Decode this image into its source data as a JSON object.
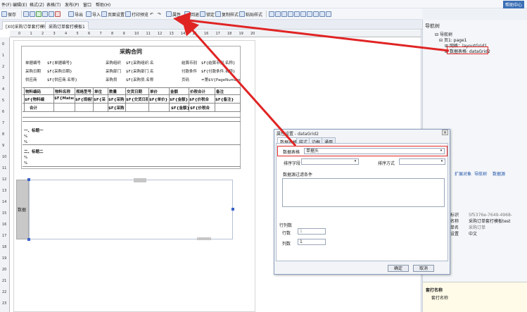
{
  "menubar": {
    "items": [
      "件(F)",
      "编辑(E)",
      "格式(Z)",
      "表格(T)",
      "发布(P)",
      "窗口",
      "帮助(H)"
    ],
    "help_link": "帮助中心"
  },
  "toolbar": {
    "save": "保存",
    "export": "导出",
    "import": "导入",
    "page_setup": "页面设置",
    "print_preview": "打印预览",
    "properties": "属性",
    "rollback": "回退",
    "lock": "锁定",
    "copy_style": "复制样式",
    "paste_style": "粘贴样式"
  },
  "tabs": [
    "[X0]采购订单套打模板",
    "采购订单套打模板1"
  ],
  "rulers": {
    "h": [
      "0",
      "1",
      "2",
      "3",
      "4",
      "5",
      "6",
      "7",
      "8",
      "9",
      "10",
      "11",
      "12",
      "13",
      "14",
      "15",
      "16",
      "17",
      "18",
      "19",
      "20"
    ],
    "v": [
      "0",
      "1",
      "2",
      "3",
      "4",
      "5",
      "6",
      "7",
      "8",
      "9",
      "10",
      "11",
      "12",
      "13",
      "14",
      "15",
      "16",
      "17",
      "18",
      "19",
      "20",
      "21",
      "22",
      "23"
    ]
  },
  "form": {
    "title": "采购合同",
    "rows": [
      [
        "单据编号",
        "$F{单据编号}",
        "采购组织",
        "$F{采购组织.名",
        "结算币别",
        "$F{结算币别.名称}"
      ],
      [
        "采购日期",
        "$F{采购日期}",
        "采购部门",
        "$F{采购部门.名",
        "付款条件",
        "$F{付款条件.名称}"
      ],
      [
        "供应商",
        "$F{供应商.名称}",
        "采购员",
        "$F{采购员.名称}",
        "页码",
        "=第$V{PageNumber}页,共$V{Tot"
      ]
    ],
    "columns": [
      "物料编码",
      "物料名称",
      "规格型号",
      "单位",
      "数量",
      "交货日期",
      "单价",
      "金额",
      "价税合计",
      "备注"
    ],
    "fields": [
      "$F{物料编",
      "$F{Materialname}",
      "$F{规格型",
      "$F{采",
      "$F{采购",
      "$F{交货日期}",
      "$F{单价}",
      "$F{金额}",
      "$F{价税合",
      "$F{备注}"
    ],
    "total_label": "合计",
    "totals": [
      "$F{采购",
      "$F{金额}",
      "$F{价税合"
    ],
    "section1": "一、标题一",
    "section2": "二、标题二",
    "percent": "%"
  },
  "band": {
    "label": "数据"
  },
  "nav": {
    "title": "导航树",
    "tree": [
      "导航树",
      "页1: page1",
      "网格：layoutGrid1",
      "数据表格: dataGrid2"
    ],
    "panel_tabs": [
      "扩展对象",
      "导航树",
      "数据源"
    ]
  },
  "dialog": {
    "title": "属性设置 - dataGrid2",
    "tabs": [
      "数据表格",
      "样式",
      "边框",
      "通用"
    ],
    "ds_label": "数据表格",
    "ds_value": "单据头",
    "sort_field_label": "排序字段",
    "sort_order_label": "排序方式",
    "filter_label": "数据源过滤条件",
    "rowcol_label": "行列数",
    "rows_label": "行数",
    "rows_value": "1",
    "cols_label": "列数",
    "cols_value": "1",
    "ok": "确定",
    "cancel": "取消",
    "close": "×"
  },
  "props": {
    "rows": [
      [
        "标识",
        "5f5376e-7649-4968-"
      ],
      [
        "名称",
        "采购订单套打模板test"
      ],
      [
        "单名",
        "采购订单"
      ],
      [
        "设置",
        "中文"
      ]
    ]
  },
  "bottom": {
    "label1": "套打名称",
    "label2": "套打名称"
  },
  "colors": {
    "accent": "#3a6fb5",
    "highlight": "#e02424"
  }
}
